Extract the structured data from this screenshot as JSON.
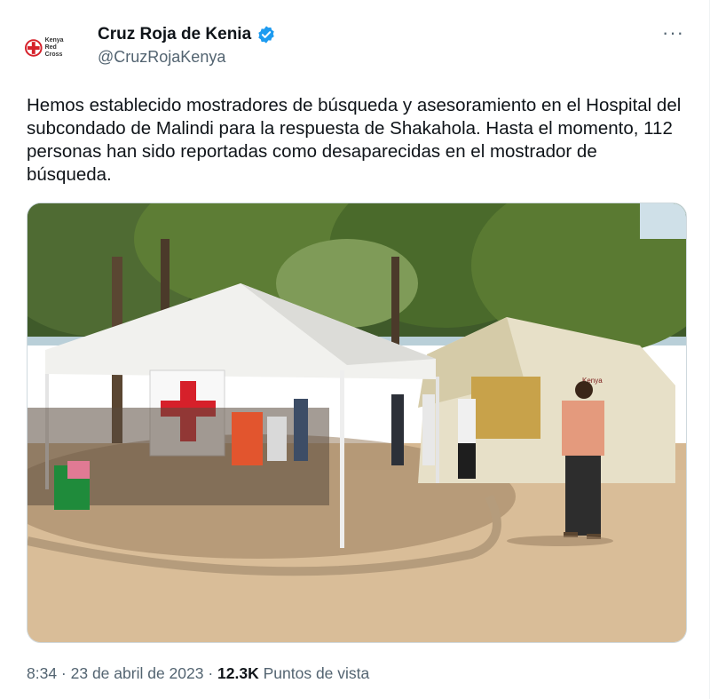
{
  "author": {
    "display_name": "Cruz Roja de Kenia",
    "handle": "@CruzRojaKenya",
    "avatar_logo_text": "Kenya Red Cross",
    "verified_color": "#1d9bf0"
  },
  "more_label": "···",
  "tweet": {
    "text": "Hemos establecido mostradores de búsqueda y asesoramiento en el Hospital del subcondado de Malindi para la respuesta de Shakahola. Hasta el momento, 112 personas han sido reportadas como desaparecidas en el mostrador de búsqueda."
  },
  "meta": {
    "time": "8:34",
    "separator": " · ",
    "date": "23 de abril de 2023",
    "views_count": "12.3K",
    "views_label": "Puntos de vista"
  },
  "media": {
    "photo_logo_text": "Kenya"
  }
}
